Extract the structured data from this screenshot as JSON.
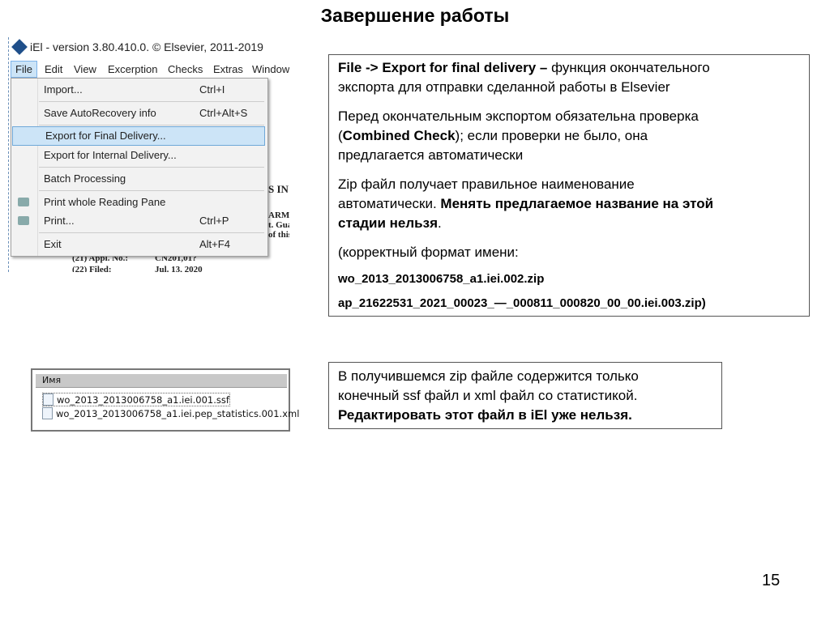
{
  "title": "Завершение работы",
  "app": {
    "window_title": "iEl - version 3.80.410.0. © Elsevier, 2011-2019",
    "menubar": [
      "File",
      "Edit",
      "View",
      "Excerption",
      "Checks",
      "Extras",
      "Window"
    ],
    "file_menu": [
      {
        "label": "Import...",
        "shortcut": "Ctrl+I"
      },
      {
        "label": "Save AutoRecovery info",
        "shortcut": "Ctrl+Alt+S"
      },
      {
        "label": "Export for Final Delivery...",
        "shortcut": "",
        "highlighted": true
      },
      {
        "label": "Export for Internal Delivery...",
        "shortcut": ""
      },
      {
        "label": "Batch Processing",
        "shortcut": ""
      },
      {
        "label": "Print whole Reading Pane",
        "shortcut": "",
        "icon": "print-preview-icon"
      },
      {
        "label": "Print...",
        "shortcut": "Ctrl+P",
        "icon": "printer-icon"
      },
      {
        "label": "Exit",
        "shortcut": "Alt+F4"
      }
    ],
    "background_doc": [
      "S IN",
      "ARM",
      "t. Gua",
      "of this",
      "(21) Appl. No.:",
      "CN201,01?",
      "(22) Filed:",
      "Jul. 13, 2020"
    ]
  },
  "files": {
    "header": "Имя",
    "items": [
      "wo_2013_2013006758_a1.iei.001.ssf",
      "wo_2013_2013006758_a1.iei.pep_statistics.001.xml"
    ]
  },
  "box1": {
    "p1a": "File -> Export for final delivery –",
    "p1b": " функция окончательного",
    "p1c": "экспорта для отправки сделанной работы в Elsevier",
    "p2a": "Перед окончательным экспортом обязательна проверка",
    "p2b": "(",
    "p2c": "Combined Check",
    "p2d": "); если проверки не было, она",
    "p2e": "предлагается автоматически",
    "p3a": "Zip файл получает правильное наименование",
    "p3b": "автоматически. ",
    "p3c": "Менять предлагаемое название на этой",
    "p3d": "стадии нельзя",
    "p3e": ".",
    "p4": "(корректный формат имени:",
    "p5": "wo_2013_2013006758_a1.iei.002.zip",
    "p6": "ap_21622531_2021_00023_—_000811_000820_00_00.iei.003.zip)"
  },
  "box2": {
    "l1": "В получившемся zip файле содержится только",
    "l2": "конечный ssf файл и xml файл со статистикой.",
    "l3": "Редактировать этот файл в iEl уже нельзя."
  },
  "page_number": "15"
}
